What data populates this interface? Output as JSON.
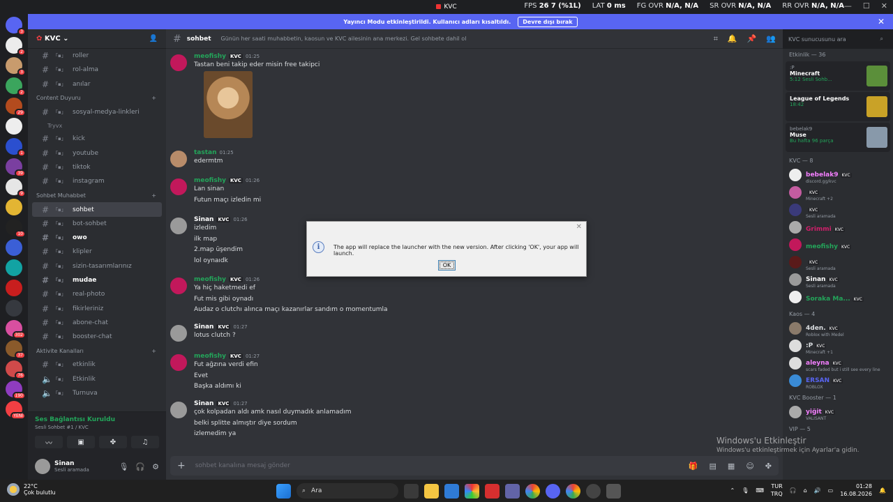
{
  "window": {
    "title": "KVC",
    "overlay": {
      "fps_label": "FPS",
      "fps": "26",
      "fps_low": "7 (%1L)",
      "lat_label": "LAT",
      "lat": "0 ms",
      "fg_label": "FG OVR",
      "fg": "N/A, N/A",
      "sr_label": "SR OVR",
      "sr": "N/A, N/A",
      "rr_label": "RR OVR",
      "rr": "N/A, N/A"
    }
  },
  "streamer": {
    "text": "Yayıncı Modu etkinleştirildi. Kullanıcı adları kısaltıldı.",
    "button": "Devre dışı bırak"
  },
  "guilds": [
    {
      "badge": "3",
      "color": "#5865f2"
    },
    {
      "badge": "2",
      "color": "#ececec"
    },
    {
      "badge": "3",
      "color": "#c89b6d"
    },
    {
      "badge": "2",
      "color": "#3ba55d"
    },
    {
      "badge": "29",
      "color": "#b34b1e"
    },
    {
      "badge": "",
      "color": "#eee"
    },
    {
      "badge": "1",
      "color": "#2b4fcf"
    },
    {
      "badge": "39",
      "color": "#7a3fa0"
    },
    {
      "badge": "9",
      "color": "#e6e6e6"
    },
    {
      "badge": "",
      "color": "#e3b533"
    },
    {
      "badge": "10",
      "color": "#222"
    },
    {
      "badge": "",
      "color": "#3b5fd6"
    },
    {
      "badge": "",
      "color": "#12a3a3"
    },
    {
      "badge": "",
      "color": "#c81e1e"
    },
    {
      "badge": "",
      "color": "#36393f"
    },
    {
      "badge": "302",
      "color": "#d84fa0"
    },
    {
      "badge": "37",
      "color": "#8a5a2b"
    },
    {
      "badge": "76",
      "color": "#d04a4a"
    },
    {
      "badge": "190",
      "color": "#8f3cbf"
    },
    {
      "badge": "YENİ",
      "color": "#f23f43"
    }
  ],
  "server": {
    "name": "KVC"
  },
  "channels": [
    {
      "type": "chan",
      "name": "roller"
    },
    {
      "type": "chan",
      "name": "rol-alma"
    },
    {
      "type": "chan",
      "name": "anılar"
    },
    {
      "type": "cat",
      "name": "Content Duyuru"
    },
    {
      "type": "chan",
      "name": "sosyal-medya-linkleri"
    },
    {
      "type": "sub",
      "name": "Tryvx"
    },
    {
      "type": "chan",
      "name": "kick"
    },
    {
      "type": "chan",
      "name": "youtube"
    },
    {
      "type": "chan",
      "name": "tiktok"
    },
    {
      "type": "chan",
      "name": "instagram"
    },
    {
      "type": "cat",
      "name": "Sohbet Muhabbet"
    },
    {
      "type": "active",
      "name": "sohbet"
    },
    {
      "type": "chan",
      "name": "bot-sohbet"
    },
    {
      "type": "bold",
      "name": "owo"
    },
    {
      "type": "chan",
      "name": "klipler"
    },
    {
      "type": "chan",
      "name": "sizin-tasarımlarınız"
    },
    {
      "type": "bold",
      "name": "mudae"
    },
    {
      "type": "chan",
      "name": "real-photo"
    },
    {
      "type": "chan",
      "name": "fikirleriniz"
    },
    {
      "type": "chan",
      "name": "abone-chat"
    },
    {
      "type": "chan",
      "name": "booster-chat"
    },
    {
      "type": "cat",
      "name": "Aktivite Kanalları"
    },
    {
      "type": "chan",
      "name": "etkinlik"
    },
    {
      "type": "voice",
      "name": "Etkinlik"
    },
    {
      "type": "voice",
      "name": "Turnuva"
    }
  ],
  "voice": {
    "title": "Ses Bağlantısı Kuruldu",
    "channel": "Sesli Sohbet #1 / KVC"
  },
  "user": {
    "name": "Sinan",
    "status": "Sesli aramada"
  },
  "channel_header": {
    "name": "sohbet",
    "topic": "Günün her saati muhabbetin, kaosun ve KVC ailesinin ana merkezi. Gel sohbete dahil ol"
  },
  "search_placeholder": "KVC sunucusunu ara",
  "messages": [
    {
      "author": "meofishy",
      "tag": "KVC",
      "time": "01:25",
      "color": "#23a55a",
      "lines": [
        "Tastan beni takip eder misin free takipci"
      ],
      "image": true,
      "av": "#c2185b"
    },
    {
      "author": "tastan",
      "tag": "",
      "time": "01:25",
      "color": "#23a55a",
      "lines": [
        "edermtm"
      ],
      "av": "#b88c6a"
    },
    {
      "author": "meofishy",
      "tag": "KVC",
      "time": "01:26",
      "color": "#23a55a",
      "lines": [
        "Lan sinan",
        "Futun maçı izledin mi"
      ],
      "av": "#c2185b"
    },
    {
      "author": "Sinan",
      "tag": "KVC",
      "time": "01:26",
      "color": "#ffffff",
      "lines": [
        "izledim",
        "ilk map",
        "2.map üşendim",
        "lol oynaıdk"
      ],
      "av": "#9a9a9a"
    },
    {
      "author": "meofishy",
      "tag": "KVC",
      "time": "01:26",
      "color": "#23a55a",
      "lines": [
        "Ya hiç haketmedi ef",
        "Fut mis gibi oynadı",
        "Audaz o clutchı alınca maçı kazanırlar sandım o momentumla"
      ],
      "av": "#c2185b"
    },
    {
      "author": "Sinan",
      "tag": "KVC",
      "time": "01:27",
      "color": "#ffffff",
      "lines": [
        "lotus clutch ?"
      ],
      "av": "#9a9a9a"
    },
    {
      "author": "meofishy",
      "tag": "KVC",
      "time": "01:27",
      "color": "#23a55a",
      "lines": [
        "Fut ağzına verdi efin",
        "Evet",
        "Başka aldımı ki"
      ],
      "av": "#c2185b"
    },
    {
      "author": "Sinan",
      "tag": "KVC",
      "time": "01:27",
      "color": "#ffffff",
      "lines": [
        "çok kolpadan aldı amk nasıl duymadık anlamadım",
        "belki splitte almıştır diye sordum",
        "izlemedim ya"
      ],
      "av": "#9a9a9a"
    }
  ],
  "composer_placeholder": "sohbet kanalına mesaj gönder",
  "members": {
    "activity_header": "Etkinlik — 36",
    "activities": [
      {
        "user": ":P",
        "title": "Minecraft",
        "sub": "5:12",
        "extra": "Sesli Sohb...",
        "thumb": "#5b8f3a"
      },
      {
        "user": "",
        "title": "League of Legends",
        "sub": "18:42",
        "extra": "",
        "thumb": "#c9a227"
      },
      {
        "user": "bebelak9",
        "title": "Muse",
        "sub": "Bu hafta 96 parça",
        "extra": "",
        "thumb": "#8899aa"
      }
    ],
    "groups": [
      {
        "header": "KVC — 8",
        "items": [
          {
            "name": "bebelak9",
            "color": "#f47fff",
            "status": "discord.gg/kvc",
            "av": "#eee"
          },
          {
            "name": "",
            "color": "#d11f6b",
            "status": "Minecraft +2",
            "av": "#c45ca0"
          },
          {
            "name": "",
            "color": "#d11f6b",
            "status": "Sesli aramada",
            "av": "#3a3a7a"
          },
          {
            "name": "Grimmi",
            "color": "#d11f6b",
            "status": "",
            "av": "#aaa"
          },
          {
            "name": "meofishy",
            "color": "#23a55a",
            "status": "",
            "av": "#c2185b"
          },
          {
            "name": "",
            "color": "#d11f6b",
            "status": "Sesli aramada",
            "av": "#5a1a1a"
          },
          {
            "name": "Sinan",
            "color": "#ffffff",
            "status": "Sesli aramada",
            "av": "#9a9a9a"
          },
          {
            "name": "Soraka Ma...",
            "color": "#23a55a",
            "status": "",
            "av": "#eee"
          }
        ]
      },
      {
        "header": "Kaos — 4",
        "items": [
          {
            "name": "4den.",
            "color": "#dbdee1",
            "status": "Roblox with Medel",
            "av": "#8a7a6a"
          },
          {
            "name": ":P",
            "color": "#dbdee1",
            "status": "Minecraft +1",
            "av": "#ddd"
          },
          {
            "name": "aleyna",
            "color": "#f47fff",
            "status": "scars faded but i still see every line",
            "av": "#ddd"
          },
          {
            "name": "ERSAN",
            "color": "#5865f2",
            "status": "ROBLOX",
            "av": "#3a8bd6"
          }
        ]
      },
      {
        "header": "KVC Booster — 1",
        "items": [
          {
            "name": "yiğit",
            "color": "#f47fff",
            "status": "VALISANT",
            "av": "#aaa"
          }
        ]
      },
      {
        "header": "VIP — 5",
        "items": []
      }
    ]
  },
  "dialog": {
    "text": "The app will replace the launcher with the new version. After clicking 'OK', your app will launch.",
    "ok": "OK"
  },
  "watermark": {
    "title": "Windows'u Etkinleştir",
    "sub": "Windows'u etkinleştirmek için Ayarlar'a gidin."
  },
  "taskbar": {
    "temp": "22°C",
    "weather": "Çok bulutlu",
    "search": "Ara",
    "lang1": "TUR",
    "lang2": "TRQ",
    "time": "01:28",
    "date": "16.08.2026"
  }
}
